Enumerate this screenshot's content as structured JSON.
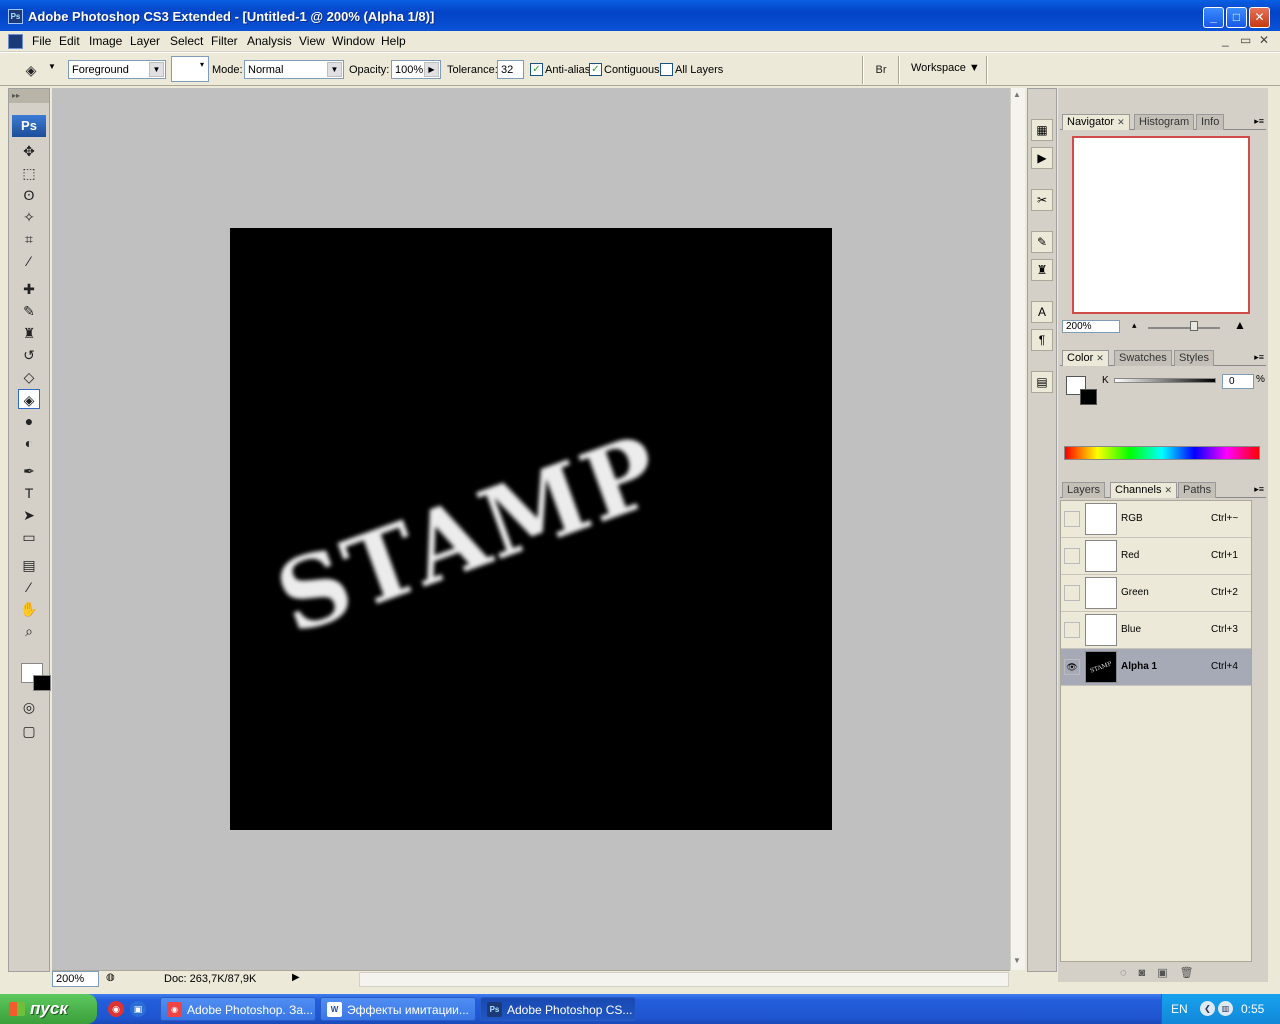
{
  "window": {
    "title": "Adobe Photoshop CS3 Extended - [Untitled-1 @ 200% (Alpha 1/8)]",
    "icon_label": "Ps",
    "controls": {
      "minimize": "_",
      "maximize": "□",
      "close": "✕"
    }
  },
  "menu": {
    "items": [
      "File",
      "Edit",
      "Image",
      "Layer",
      "Select",
      "Filter",
      "Analysis",
      "View",
      "Window",
      "Help"
    ],
    "mdi_controls": [
      "_",
      "▭",
      "✕"
    ]
  },
  "options": {
    "fill_source": "Foreground",
    "mode_label": "Mode:",
    "mode_value": "Normal",
    "opacity_label": "Opacity:",
    "opacity_value": "100%",
    "tolerance_label": "Tolerance:",
    "tolerance_value": "32",
    "anti_alias_label": "Anti-alias",
    "anti_alias_checked": true,
    "contiguous_label": "Contiguous",
    "contiguous_checked": true,
    "all_layers_label": "All Layers",
    "all_layers_checked": false,
    "workspace_label": "Workspace",
    "check_mark": "✓"
  },
  "toolbox": {
    "grip": "▸▸",
    "logo": "Ps",
    "tools": [
      {
        "name": "move-tool-icon",
        "glyph": "✥"
      },
      {
        "name": "marquee-tool-icon",
        "glyph": "⬚"
      },
      {
        "name": "lasso-tool-icon",
        "glyph": "ʘ"
      },
      {
        "name": "magic-wand-tool-icon",
        "glyph": "✧"
      },
      {
        "name": "crop-tool-icon",
        "glyph": "⌗"
      },
      {
        "name": "slice-tool-icon",
        "glyph": "⁄"
      },
      {
        "name": "healing-brush-tool-icon",
        "glyph": "✚"
      },
      {
        "name": "brush-tool-icon",
        "glyph": "✎"
      },
      {
        "name": "clone-stamp-tool-icon",
        "glyph": "♜"
      },
      {
        "name": "history-brush-tool-icon",
        "glyph": "↺"
      },
      {
        "name": "eraser-tool-icon",
        "glyph": "◇"
      },
      {
        "name": "paint-bucket-tool-icon",
        "glyph": "◈"
      },
      {
        "name": "blur-tool-icon",
        "glyph": "●"
      },
      {
        "name": "dodge-tool-icon",
        "glyph": "◐"
      },
      {
        "name": "pen-tool-icon",
        "glyph": "✒"
      },
      {
        "name": "type-tool-icon",
        "glyph": "T"
      },
      {
        "name": "path-selection-tool-icon",
        "glyph": "➤"
      },
      {
        "name": "shape-tool-icon",
        "glyph": "▭"
      },
      {
        "name": "notes-tool-icon",
        "glyph": "▤"
      },
      {
        "name": "eyedropper-tool-icon",
        "glyph": "⁄"
      },
      {
        "name": "hand-tool-icon",
        "glyph": "✋"
      },
      {
        "name": "zoom-tool-icon",
        "glyph": "⌕"
      },
      {
        "name": "quick-mask-icon",
        "glyph": "◎"
      },
      {
        "name": "screen-mode-icon",
        "glyph": "▢"
      }
    ],
    "active_tool": "paint-bucket-tool-icon"
  },
  "document": {
    "canvas_text": "STAMP",
    "zoom": "200%",
    "doc_info": "Doc: 263,7K/87,9K"
  },
  "navigator": {
    "tabs": [
      {
        "label": "Navigator",
        "closable": true,
        "active": true
      },
      {
        "label": "Histogram"
      },
      {
        "label": "Info"
      }
    ],
    "zoom": "200%"
  },
  "color": {
    "tabs": [
      {
        "label": "Color",
        "closable": true,
        "active": true
      },
      {
        "label": "Swatches"
      },
      {
        "label": "Styles"
      }
    ],
    "k_label": "K",
    "k_value": "0",
    "pct": "%"
  },
  "channels": {
    "tabs": [
      {
        "label": "Layers"
      },
      {
        "label": "Channels",
        "closable": true,
        "active": true
      },
      {
        "label": "Paths"
      }
    ],
    "rows": [
      {
        "name": "RGB",
        "shortcut": "Ctrl+~",
        "visible": false,
        "selected": false
      },
      {
        "name": "Red",
        "shortcut": "Ctrl+1",
        "visible": false,
        "selected": false
      },
      {
        "name": "Green",
        "shortcut": "Ctrl+2",
        "visible": false,
        "selected": false
      },
      {
        "name": "Blue",
        "shortcut": "Ctrl+3",
        "visible": false,
        "selected": false
      },
      {
        "name": "Alpha 1",
        "shortcut": "Ctrl+4",
        "visible": true,
        "selected": true
      }
    ]
  },
  "taskbar": {
    "start_label": "пуск",
    "tasks": [
      {
        "label": "Adobe Photoshop. За...",
        "icon": "chrome-icon",
        "active": false
      },
      {
        "label": "Эффекты имитации...",
        "icon": "word-icon",
        "active": false
      },
      {
        "label": "Adobe Photoshop CS...",
        "icon": "photoshop-icon",
        "active": true
      }
    ],
    "language": "EN",
    "clock": "0:55"
  },
  "colors": {
    "titlebar": "#0343c6",
    "canvas_bg": "#000000",
    "workspace_bg": "#c0c0c0",
    "navigator_frame": "#d24b4b",
    "selected_row": "#a6aab6"
  }
}
